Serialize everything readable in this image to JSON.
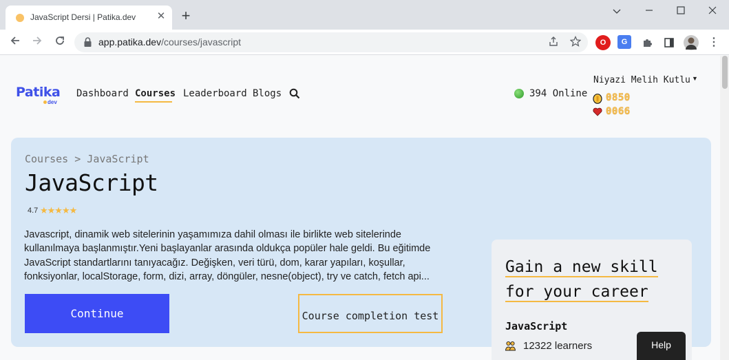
{
  "browser": {
    "tab_title": "JavaScript Dersi | Patika.dev",
    "tab_close": "✕",
    "new_tab": "+",
    "window_controls": {
      "minimize": "⌵",
      "maximize": "☐",
      "close": "✕"
    },
    "url_host": "app.patika.dev",
    "url_path": "/courses/javascript",
    "extensions": [
      "opera-icon",
      "translate-icon",
      "puzzle-icon",
      "sidepanel-icon",
      "profile-avatar-icon",
      "menu-icon"
    ]
  },
  "header": {
    "logo_text": "Patika",
    "logo_sub": "dev",
    "nav": [
      {
        "label": "Dashboard",
        "active": false
      },
      {
        "label": "Courses",
        "active": true
      },
      {
        "label": "Leaderboard",
        "active": false
      },
      {
        "label": "Blogs",
        "active": false
      }
    ],
    "online_text": "394 Online",
    "user_name": "Niyazi Melih Kutlu",
    "coins": "0850",
    "hearts": "0066"
  },
  "hero": {
    "breadcrumb": "Courses > JavaScript",
    "title": "JavaScript",
    "rating": "4.7",
    "stars": "★★★★★",
    "description": "Javascript, dinamik web sitelerinin yaşamımıza dahil olması ile birlikte web sitelerinde kullanılmaya başlanmıştır.Yeni başlayanlar arasında oldukça popüler hale geldi. Bu eğitimde JavaScript standartlarını tanıyacağız. Değişken, veri türü, dom, karar yapıları, koşullar, fonksiyonlar, localStorage, form, dizi, array, döngüler, nesne(object), try ve catch, fetch api...",
    "continue_label": "Continue",
    "test_label": "Course completion test"
  },
  "side_card": {
    "heading_line1": "Gain a new skill",
    "heading_line2": "for your career",
    "course_name": "JavaScript",
    "learners": "12322 learners"
  },
  "help_label": "Help",
  "colors": {
    "brand": "#3d4cf5",
    "accent": "#f5b942",
    "hero_bg": "#d7e7f6"
  }
}
